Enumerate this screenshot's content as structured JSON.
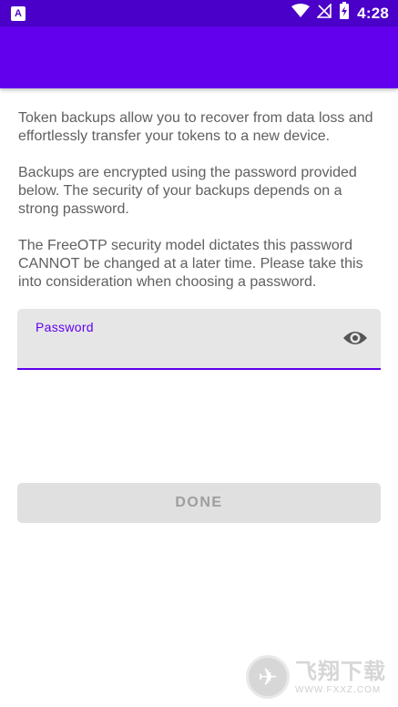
{
  "status_bar": {
    "left_icon_label": "A",
    "time": "4:28",
    "icons": [
      "wifi-icon",
      "no-signal-icon",
      "battery-charging-icon"
    ]
  },
  "app_bar": {
    "title": ""
  },
  "paragraphs": [
    "Token backups allow you to recover from data loss and effortlessly transfer your tokens to a new device.",
    "Backups are encrypted using the password provided below. The security of your backups depends on a strong password.",
    "The FreeOTP security model dictates this password CANNOT be changed at a later time. Please take this into consideration when choosing a password."
  ],
  "password_field": {
    "label": "Password",
    "value": "",
    "toggle_icon": "eye-icon"
  },
  "done_button": {
    "label": "DONE",
    "enabled": false
  },
  "watermark": {
    "main": "飞翔下载",
    "sub": "WWW.FXXZ.COM"
  },
  "colors": {
    "status_bar": "#4a00c8",
    "primary": "#6200ee",
    "body_text": "#606060",
    "field_bg": "#e6e6e6",
    "button_disabled_bg": "#e0e0e0",
    "button_disabled_text": "#9e9e9e"
  }
}
